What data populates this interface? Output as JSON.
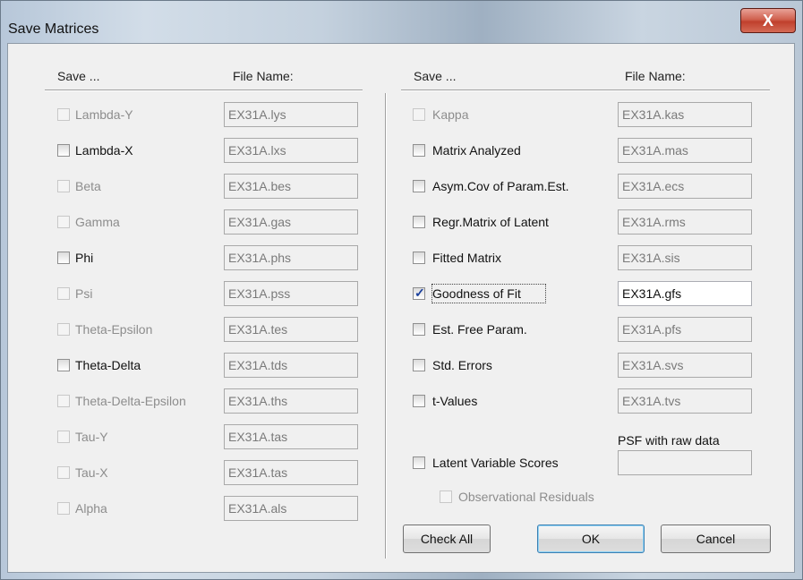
{
  "window": {
    "title": "Save Matrices",
    "close_glyph": "X"
  },
  "left": {
    "save_header": "Save ...",
    "file_header": "File Name:",
    "rows": [
      {
        "label": "Lambda-Y",
        "file": "EX31A.lys",
        "checked": false,
        "enabled": false
      },
      {
        "label": "Lambda-X",
        "file": "EX31A.lxs",
        "checked": false,
        "enabled": true
      },
      {
        "label": "Beta",
        "file": "EX31A.bes",
        "checked": false,
        "enabled": false
      },
      {
        "label": "Gamma",
        "file": "EX31A.gas",
        "checked": false,
        "enabled": false
      },
      {
        "label": "Phi",
        "file": "EX31A.phs",
        "checked": false,
        "enabled": true
      },
      {
        "label": "Psi",
        "file": "EX31A.pss",
        "checked": false,
        "enabled": false
      },
      {
        "label": "Theta-Epsilon",
        "file": "EX31A.tes",
        "checked": false,
        "enabled": false
      },
      {
        "label": "Theta-Delta",
        "file": "EX31A.tds",
        "checked": false,
        "enabled": true
      },
      {
        "label": "Theta-Delta-Epsilon",
        "file": "EX31A.ths",
        "checked": false,
        "enabled": false
      },
      {
        "label": "Tau-Y",
        "file": "EX31A.tas",
        "checked": false,
        "enabled": false
      },
      {
        "label": "Tau-X",
        "file": "EX31A.tas",
        "checked": false,
        "enabled": false
      },
      {
        "label": "Alpha",
        "file": "EX31A.als",
        "checked": false,
        "enabled": false
      }
    ]
  },
  "right": {
    "save_header": "Save ...",
    "file_header": "File Name:",
    "rows": [
      {
        "label": "Kappa",
        "file": "EX31A.kas",
        "checked": false,
        "enabled": false
      },
      {
        "label": "Matrix Analyzed",
        "file": "EX31A.mas",
        "checked": false,
        "enabled": true
      },
      {
        "label": "Asym.Cov of Param.Est.",
        "file": "EX31A.ecs",
        "checked": false,
        "enabled": true
      },
      {
        "label": "Regr.Matrix of Latent",
        "file": "EX31A.rms",
        "checked": false,
        "enabled": true
      },
      {
        "label": "Fitted Matrix",
        "file": "EX31A.sis",
        "checked": false,
        "enabled": true
      },
      {
        "label": "Goodness of Fit",
        "file": "EX31A.gfs",
        "checked": true,
        "enabled": true,
        "field_active": true
      },
      {
        "label": "Est. Free Param.",
        "file": "EX31A.pfs",
        "checked": false,
        "enabled": true
      },
      {
        "label": "Std. Errors",
        "file": "EX31A.svs",
        "checked": false,
        "enabled": true
      },
      {
        "label": "t-Values",
        "file": "EX31A.tvs",
        "checked": false,
        "enabled": true
      }
    ],
    "latent": {
      "label": "Latent Variable Scores",
      "checked": false,
      "enabled": true,
      "psf_label": "PSF with raw data",
      "psf_value": ""
    },
    "obs_residuals": {
      "label": "Observational Residuals",
      "checked": false,
      "enabled": false
    }
  },
  "buttons": {
    "check_all": "Check All",
    "ok": "OK",
    "cancel": "Cancel"
  }
}
